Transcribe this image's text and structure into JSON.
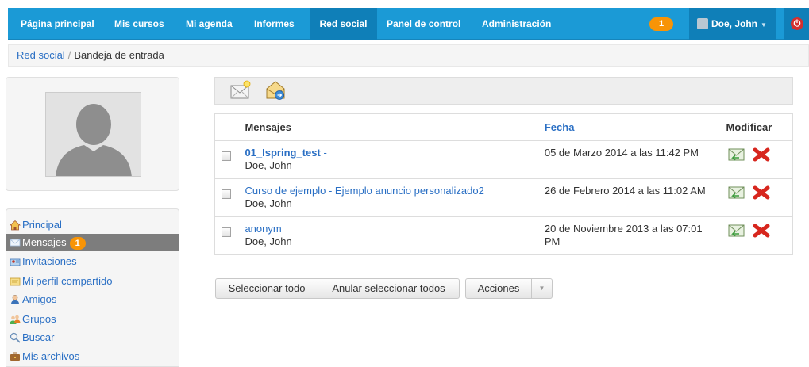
{
  "nav": {
    "items": [
      "Página principal",
      "Mis cursos",
      "Mi agenda",
      "Informes",
      "Red social",
      "Panel de control",
      "Administración"
    ],
    "active": "Red social",
    "notification_count": "1",
    "user_name": "Doe, John",
    "brand_color": "#1b9ad6"
  },
  "breadcrumb": {
    "root": "Red social",
    "separator": "/",
    "current": "Bandeja de entrada"
  },
  "sidebar": {
    "items": [
      {
        "label": "Principal",
        "icon": "home-icon"
      },
      {
        "label": "Mensajes",
        "icon": "envelope-icon",
        "badge": "1"
      },
      {
        "label": "Invitaciones",
        "icon": "invitation-icon"
      },
      {
        "label": "Mi perfil compartido",
        "icon": "shared-profile-icon"
      },
      {
        "label": "Amigos",
        "icon": "friends-icon"
      },
      {
        "label": "Grupos",
        "icon": "groups-icon"
      },
      {
        "label": "Buscar",
        "icon": "search-icon"
      },
      {
        "label": "Mis archivos",
        "icon": "files-icon"
      }
    ]
  },
  "table": {
    "headers": {
      "messages": "Mensajes",
      "date": "Fecha",
      "modify": "Modificar"
    },
    "rows": [
      {
        "subject": "01_Ispring_test",
        "suffix": " -",
        "sender": "Doe, John",
        "date": "05 de Marzo 2014 a las 11:42 PM",
        "bold": true
      },
      {
        "subject": "Curso de ejemplo - Ejemplo anuncio personalizado2",
        "suffix": "",
        "sender": "Doe, John",
        "date": "26 de Febrero 2014 a las 11:02 AM",
        "bold": false
      },
      {
        "subject": "anonym",
        "suffix": "",
        "sender": "Doe, John",
        "date": "20 de Noviembre 2013 a las 07:01 PM",
        "bold": false
      }
    ]
  },
  "actions": {
    "select_all": "Seleccionar todo",
    "unselect_all": "Anular seleccionar todos",
    "actions": "Acciones"
  }
}
